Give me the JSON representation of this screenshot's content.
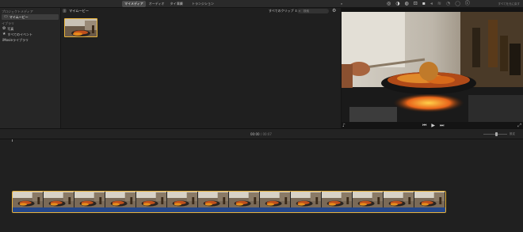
{
  "toolbar": {
    "tabs": [
      {
        "label": "マイメディア",
        "active": true
      },
      {
        "label": "オーディオ",
        "active": false
      },
      {
        "label": "タイトル",
        "active": false
      }
    ],
    "bg_label": "背景",
    "transition_label": "トランジション",
    "right_hint": "すべてを元に戻す",
    "tool_icons": [
      "magic-wand-icon",
      "color-balance-icon",
      "color-correction-icon",
      "crop-icon",
      "stabilization-icon",
      "volume-icon",
      "noise-reduction-icon",
      "speed-icon",
      "filter-icon",
      "info-icon"
    ]
  },
  "sidebar": {
    "project_media_label": "プロジェクトメディア",
    "library_label": "イブラリ",
    "items": [
      {
        "label": "マイムービー",
        "icon": "film-icon",
        "selected": true
      },
      {
        "label": "写真",
        "icon": "photos-icon",
        "selected": false
      },
      {
        "label": "すべてのイベント",
        "icon": "star-icon",
        "selected": false
      },
      {
        "label": "iMovieライブラリ",
        "icon": "",
        "selected": false
      }
    ]
  },
  "browser": {
    "title": "マイムービー",
    "filter_label": "すべてのクリップ ⇕",
    "search_placeholder": "検索"
  },
  "viewer": {
    "controls": [
      "skip-back-icon",
      "play-icon",
      "skip-forward-icon"
    ]
  },
  "timeline": {
    "current_time": "00:00",
    "total_time": "00:07",
    "settings_label": "設定",
    "frame_count": 14
  },
  "colors": {
    "accent": "#e7b23b",
    "audio": "#24478a",
    "background": "#1e1e1e"
  }
}
